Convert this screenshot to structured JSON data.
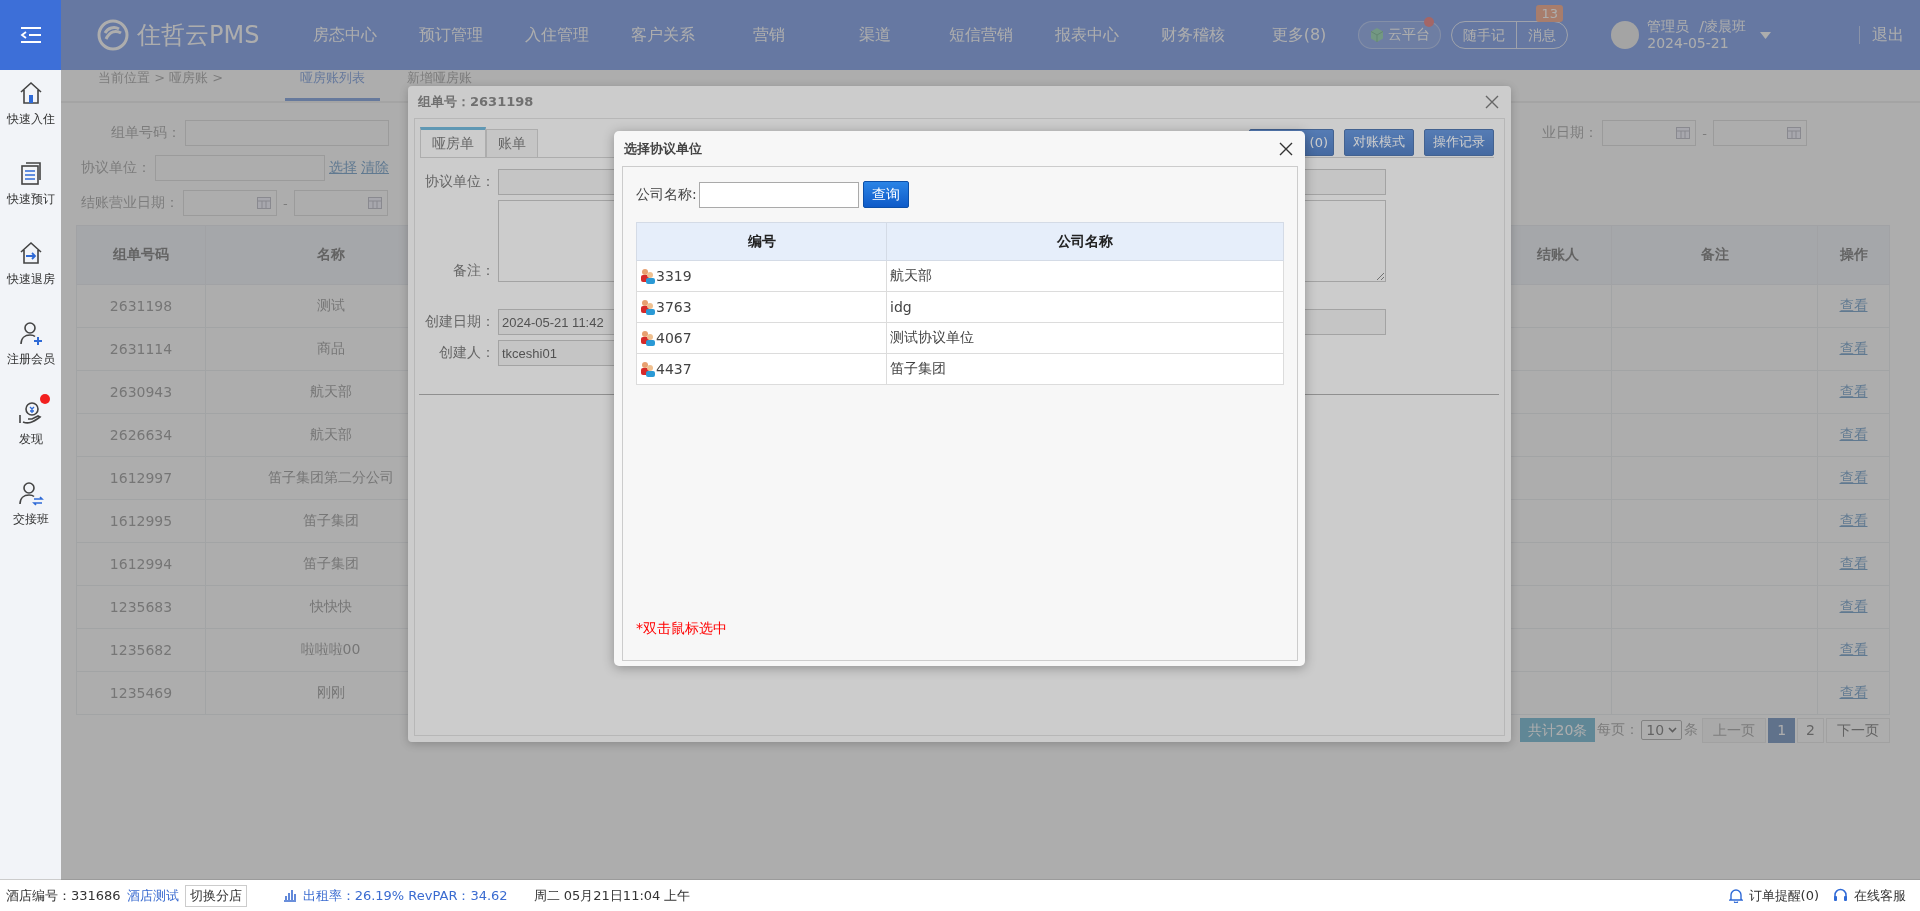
{
  "header": {
    "logo": "住哲云PMS",
    "nav": [
      "房态中心",
      "预订管理",
      "入住管理",
      "客户关系",
      "营销",
      "渠道",
      "短信营销",
      "报表中心",
      "财务稽核",
      "更多(8)"
    ],
    "cloud_platform": {
      "label": "云平台",
      "alert": true
    },
    "notes": "随手记",
    "messages": "消息",
    "message_count": "13",
    "user_role": "管理员",
    "shift": "/凌晨班",
    "date": "2024-05-21",
    "logout": "退出"
  },
  "sidebar": {
    "items": [
      {
        "label": "快速入住",
        "kind": "checkin",
        "badge": false
      },
      {
        "label": "快速预订",
        "kind": "booking",
        "badge": false
      },
      {
        "label": "快速退房",
        "kind": "checkout",
        "badge": false
      },
      {
        "label": "注册会员",
        "kind": "member",
        "badge": false
      },
      {
        "label": "发现",
        "kind": "discover",
        "badge": true
      },
      {
        "label": "交接班",
        "kind": "handover",
        "badge": false
      }
    ]
  },
  "breadcrumb": "当前位置 > 哑房账 >",
  "page_tabs": [
    {
      "label": "哑房账列表",
      "selected": true
    },
    {
      "label": "新增哑房账",
      "selected": false
    }
  ],
  "filters": {
    "group_no_label": "组单号码：",
    "unit_label": "协议单位：",
    "select_link": "选择",
    "clear_link": "清除",
    "checkout_date_label": "结账营业日期：",
    "date_separator": "-",
    "biz_date_label": "业日期：",
    "biz_date_separator": "-"
  },
  "table": {
    "columns": [
      "组单号码",
      "名称",
      "结账人",
      "备注",
      "操作"
    ],
    "rows": [
      {
        "group_no": "2631198",
        "name": "测试",
        "action": "查看"
      },
      {
        "group_no": "2631114",
        "name": "商品",
        "action": "查看"
      },
      {
        "group_no": "2630943",
        "name": "航天部",
        "action": "查看"
      },
      {
        "group_no": "2626634",
        "name": "航天部",
        "action": "查看"
      },
      {
        "group_no": "1612997",
        "name": "笛子集团第二分公司",
        "action": "查看"
      },
      {
        "group_no": "1612995",
        "name": "笛子集团",
        "action": "查看"
      },
      {
        "group_no": "1612994",
        "name": "笛子集团",
        "action": "查看"
      },
      {
        "group_no": "1235683",
        "name": "快快快",
        "action": "查看"
      },
      {
        "group_no": "1235682",
        "name": "啦啦啦00",
        "action": "查看"
      },
      {
        "group_no": "1235469",
        "name": "刚刚",
        "action": "查看"
      }
    ]
  },
  "pagination": {
    "total": "共计20条",
    "per_page_label": "每页：",
    "per_page": "10",
    "per_page_unit": "条",
    "prev": {
      "label": "上一页",
      "disabled": true
    },
    "pages": [
      {
        "label": "1",
        "selected": true
      },
      {
        "label": "2",
        "selected": false
      }
    ],
    "next": {
      "label": "下一页",
      "disabled": false
    }
  },
  "order_dialog": {
    "title": "组单号：2631198",
    "tabs": [
      {
        "label": "哑房单",
        "selected": true
      },
      {
        "label": "账单",
        "selected": false
      }
    ],
    "buttons": [
      "(0)",
      "对账模式",
      "操作记录"
    ],
    "unit_label": "协议单位：",
    "remark_label": "备注：",
    "created_date_label": "创建日期：",
    "created_date": "2024-05-21 11:42",
    "creator_label": "创建人：",
    "creator": "tkceshi01"
  },
  "unit_dialog": {
    "title": "选择协议单位",
    "search_label": "公司名称:",
    "search_button": "查询",
    "columns": [
      "编号",
      "公司名称"
    ],
    "rows": [
      {
        "code": "3319",
        "name": "航天部"
      },
      {
        "code": "3763",
        "name": "idg"
      },
      {
        "code": "4067",
        "name": "测试协议单位"
      },
      {
        "code": "4437",
        "name": "笛子集团"
      }
    ],
    "hint": "*双击鼠标选中"
  },
  "status_bar": {
    "hotel_no": "酒店编号：331686",
    "hotel_name": "酒店测试",
    "switch_button": "切换分店",
    "occupancy": "出租率：26.19% RevPAR：34.62",
    "datetime": "周二 05月21日11:04 上午",
    "order_alert": "订单提醒(0)",
    "support": "在线客服"
  }
}
